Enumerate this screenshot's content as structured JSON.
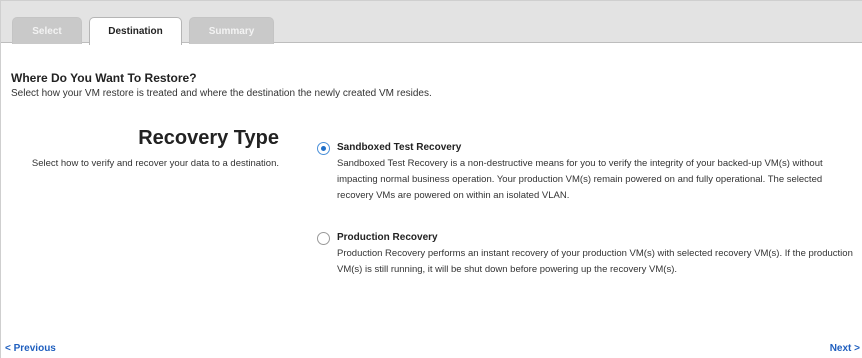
{
  "tabs": [
    {
      "label": "Select",
      "state": "inactive"
    },
    {
      "label": "Destination",
      "state": "active"
    },
    {
      "label": "Summary",
      "state": "inactive"
    }
  ],
  "page": {
    "heading": "Where Do You Want To Restore?",
    "subheading": "Select how your VM restore is treated and where the destination the newly created VM resides."
  },
  "recovery_type": {
    "title": "Recovery Type",
    "description": "Select how to verify and recover your data to a destination.",
    "options": [
      {
        "label": "Sandboxed Test Recovery",
        "selected": true,
        "description": "Sandboxed Test Recovery is a non-destructive means for you to verify the integrity of your backed-up VM(s) without impacting normal business operation. Your production VM(s) remain powered on and fully operational. The selected recovery VMs are powered on within an isolated VLAN."
      },
      {
        "label": "Production Recovery",
        "selected": false,
        "description": "Production Recovery performs an instant recovery of your production VM(s) with selected recovery VM(s). If the production VM(s) is still running, it will be shut down before powering up the recovery VM(s)."
      }
    ]
  },
  "nav": {
    "previous_label": "< Previous",
    "next_label": "Next >"
  },
  "colors": {
    "accent": "#1f6fc9",
    "link": "#1f5fbf",
    "tabbar_bg": "#e3e3e3"
  }
}
